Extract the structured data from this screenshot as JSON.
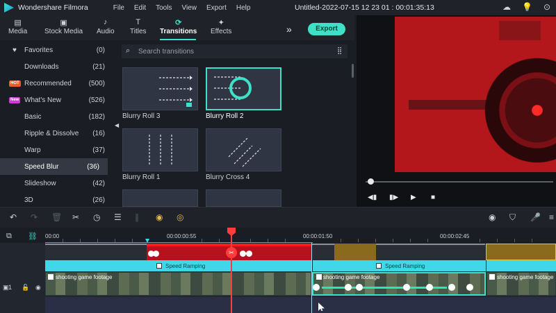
{
  "app": {
    "name": "Wondershare Filmora",
    "document_title": "Untitled-2022-07-15 12 23 01 : 00:01:35:13"
  },
  "menu": [
    "File",
    "Edit",
    "Tools",
    "View",
    "Export",
    "Help"
  ],
  "tabs": [
    {
      "label": "Media",
      "icon": "media-icon"
    },
    {
      "label": "Stock Media",
      "icon": "stock-media-icon"
    },
    {
      "label": "Audio",
      "icon": "music-note-icon"
    },
    {
      "label": "Titles",
      "icon": "text-t-icon"
    },
    {
      "label": "Transitions",
      "icon": "transitions-icon",
      "active": true
    },
    {
      "label": "Effects",
      "icon": "sparkle-icon"
    }
  ],
  "export_label": "Export",
  "categories": [
    {
      "name": "Favorites",
      "count": "(0)",
      "icon": "heart-icon"
    },
    {
      "name": "Downloads",
      "count": "(21)"
    },
    {
      "name": "Recommended",
      "count": "(500)",
      "badge": "HOT"
    },
    {
      "name": "What's New",
      "count": "(526)",
      "badge": "New"
    },
    {
      "name": "Basic",
      "count": "(182)"
    },
    {
      "name": "Ripple & Dissolve",
      "count": "(16)"
    },
    {
      "name": "Warp",
      "count": "(37)"
    },
    {
      "name": "Speed Blur",
      "count": "(36)",
      "active": true
    },
    {
      "name": "Slideshow",
      "count": "(42)"
    },
    {
      "name": "3D",
      "count": "(26)"
    }
  ],
  "search": {
    "placeholder": "Search transitions"
  },
  "transitions": [
    {
      "label": "Blurry Roll 3"
    },
    {
      "label": "Blurry Roll 2",
      "selected": true
    },
    {
      "label": "Blurry Roll 1"
    },
    {
      "label": "Blurry Cross 4"
    }
  ],
  "timeline": {
    "times": [
      "00:00",
      "00:00:00:55",
      "00:00:01:50",
      "00:00:02:45"
    ],
    "speed_label": "Speed Ramping",
    "clip_title": "shooting game footage",
    "track_number": "1"
  },
  "colors": {
    "accent": "#3fe0c8",
    "playhead": "#ff3b3b",
    "speed_bar": "#3ed8e8",
    "red_clip": "#b5121b"
  }
}
